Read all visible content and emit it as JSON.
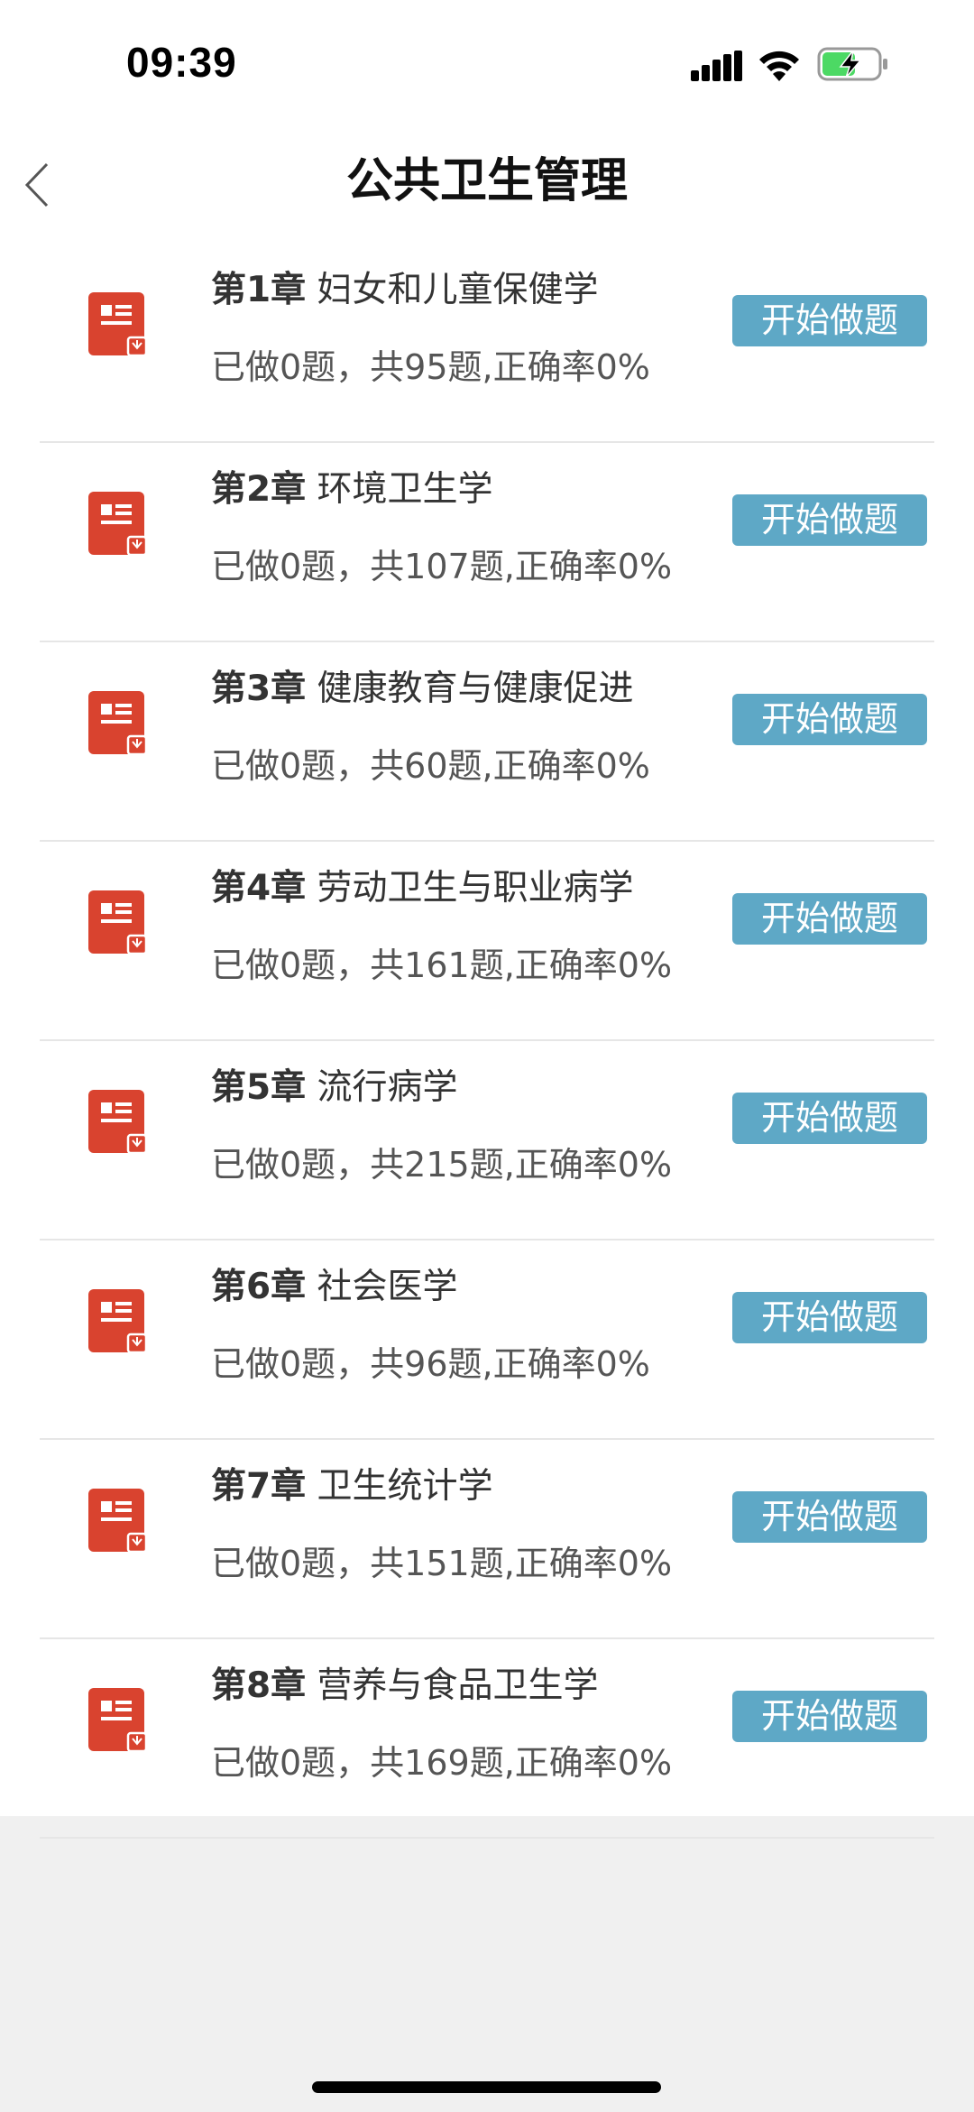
{
  "status_bar": {
    "time": "09:39",
    "icons": [
      "signal-icon",
      "wifi-icon",
      "battery-charging-icon"
    ]
  },
  "nav": {
    "back_icon": "chevron-left-icon",
    "title": "公共卫生管理"
  },
  "colors": {
    "button_bg": "#5ea8c6",
    "icon_red": "#d9432f",
    "page_bg": "#f0f0f0"
  },
  "chapters": [
    {
      "chapter": "第1章",
      "name": "妇女和儿童保健学",
      "stats": "已做0题，共95题,正确率0%",
      "button": "开始做题"
    },
    {
      "chapter": "第2章",
      "name": "环境卫生学",
      "stats": "已做0题，共107题,正确率0%",
      "button": "开始做题"
    },
    {
      "chapter": "第3章",
      "name": "健康教育与健康促进",
      "stats": "已做0题，共60题,正确率0%",
      "button": "开始做题"
    },
    {
      "chapter": "第4章",
      "name": "劳动卫生与职业病学",
      "stats": "已做0题，共161题,正确率0%",
      "button": "开始做题"
    },
    {
      "chapter": "第5章",
      "name": "流行病学",
      "stats": "已做0题，共215题,正确率0%",
      "button": "开始做题"
    },
    {
      "chapter": "第6章",
      "name": "社会医学",
      "stats": "已做0题，共96题,正确率0%",
      "button": "开始做题"
    },
    {
      "chapter": "第7章",
      "name": "卫生统计学",
      "stats": "已做0题，共151题,正确率0%",
      "button": "开始做题"
    },
    {
      "chapter": "第8章",
      "name": "营养与食品卫生学",
      "stats": "已做0题，共169题,正确率0%",
      "button": "开始做题"
    }
  ]
}
